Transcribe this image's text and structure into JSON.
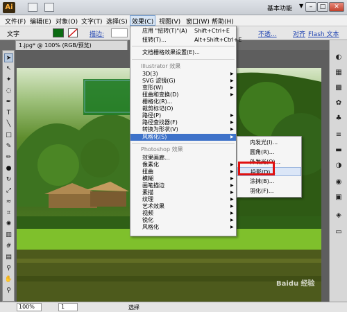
{
  "titlebar": {
    "logo": "Ai",
    "workspace": "基本功能",
    "minimize": "–",
    "maximize": "□",
    "close": "✕"
  },
  "menubar": {
    "items": [
      "文件(F)",
      "编辑(E)",
      "对象(O)",
      "文字(T)",
      "选择(S)",
      "效果(C)",
      "视图(V)",
      "窗口(W)",
      "帮助(H)"
    ]
  },
  "controlbar": {
    "tool_label": "文字",
    "stroke_label": "描边:",
    "opacity_label": "不透...",
    "transform_label": "对齐",
    "flash_label": "Flash 文本"
  },
  "document": {
    "tab_title": "1.jpg* @ 100% (RGB/预览)"
  },
  "effect_menu": {
    "apply_last": {
      "label": "应用 \"扭转(T)\"(A)",
      "shortcut": "Shift+Ctrl+E"
    },
    "last_effect": {
      "label": "扭转(T)...",
      "shortcut": "Alt+Shift+Ctrl+E"
    },
    "raster_settings": "文档栅格效果设置(E)...",
    "illustrator_header": "Illustrator 效果",
    "illustrator_items": [
      "3D(3)",
      "SVG 滤镜(G)",
      "变形(W)",
      "扭曲和变换(D)",
      "栅格化(R)...",
      "裁剪标记(O)",
      "路径(P)",
      "路径查找器(F)",
      "转换为形状(V)",
      "风格化(S)"
    ],
    "photoshop_header": "Photoshop 效果",
    "photoshop_items": [
      "效果画廊...",
      "像素化",
      "扭曲",
      "模糊",
      "画笔描边",
      "素描",
      "纹理",
      "艺术效果",
      "视频",
      "锐化",
      "风格化"
    ]
  },
  "stylize_submenu": {
    "items": [
      "内发光(I)...",
      "圆角(R)...",
      "外发光(O)...",
      "投影(D)...",
      "涂抹(B)...",
      "羽化(F)..."
    ],
    "highlighted": "投影(D)..."
  },
  "statusbar": {
    "zoom": "100%",
    "page": "1",
    "tool": "选择"
  },
  "colors": {
    "menu_highlight": "#3e72c9",
    "callout_red": "#e01010",
    "fill_green": "#0b6b12"
  }
}
